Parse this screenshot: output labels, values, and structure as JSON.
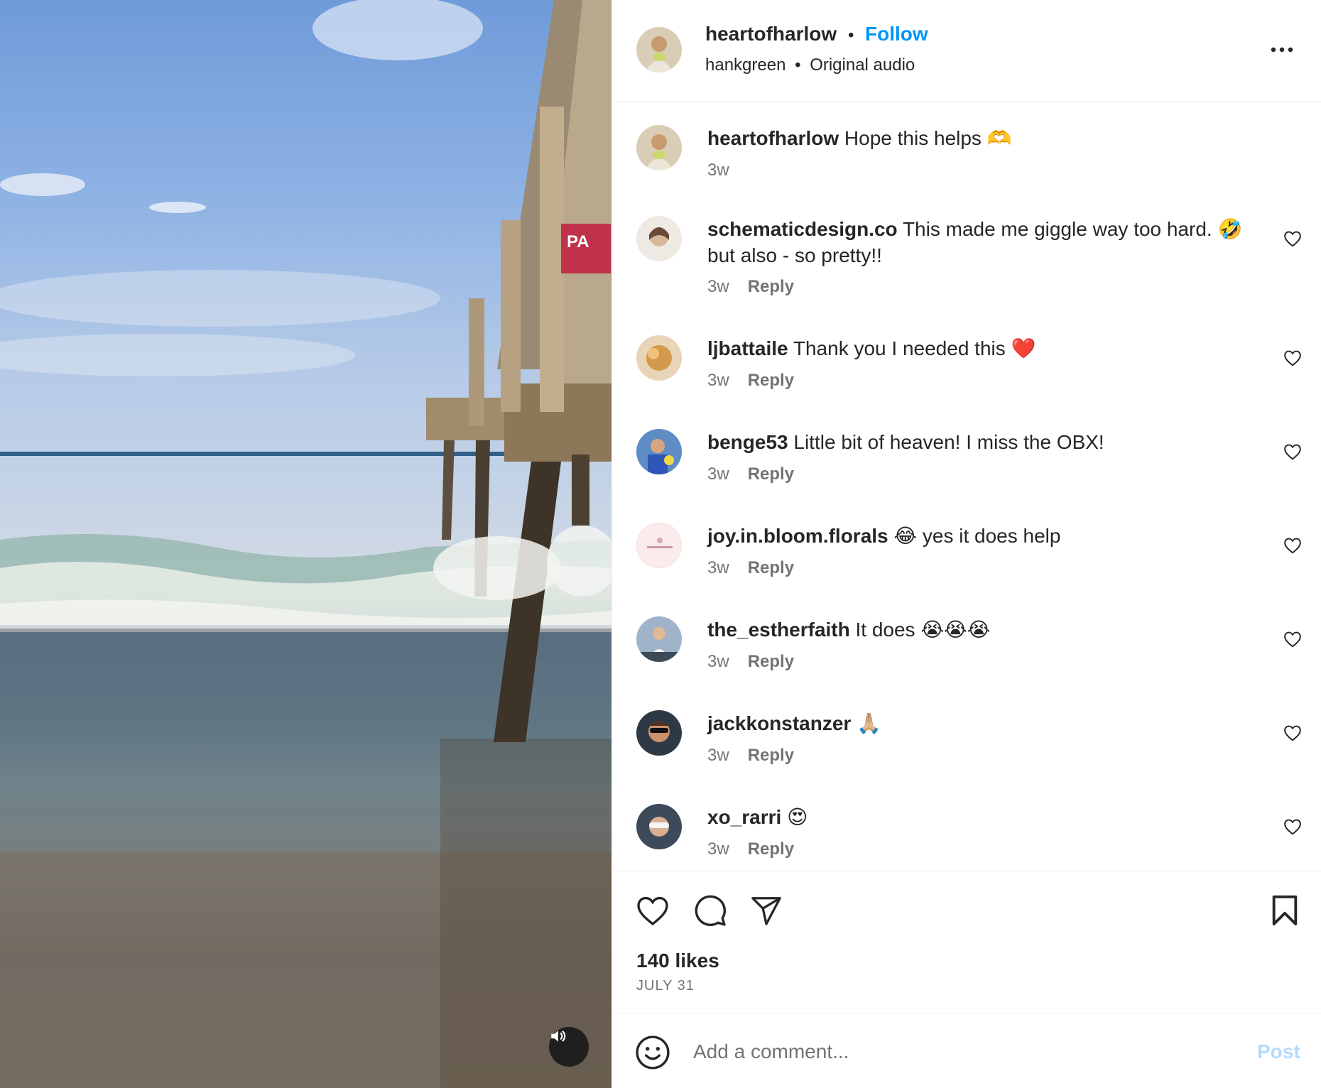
{
  "header": {
    "username": "heartofharlow",
    "separator": "•",
    "follow_label": "Follow",
    "audio_user": "hankgreen",
    "audio_separator": "•",
    "audio_label": "Original audio"
  },
  "comments": [
    {
      "username": "heartofharlow",
      "text": "Hope this helps 🫶",
      "time": "3w",
      "reply": ""
    },
    {
      "username": "schematicdesign.co",
      "text": "This made me giggle way too hard. 🤣 but also - so pretty!!",
      "time": "3w",
      "reply": "Reply"
    },
    {
      "username": "ljbattaile",
      "text": "Thank you I needed this ❤️",
      "time": "3w",
      "reply": "Reply"
    },
    {
      "username": "benge53",
      "text": "Little bit of heaven! I miss the OBX!",
      "time": "3w",
      "reply": "Reply"
    },
    {
      "username": "joy.in.bloom.florals",
      "text": "😂 yes it does help",
      "time": "3w",
      "reply": "Reply"
    },
    {
      "username": "the_estherfaith",
      "text": "It does 😭😭😭",
      "time": "3w",
      "reply": "Reply"
    },
    {
      "username": "jackkonstanzer",
      "text": "🙏🏼",
      "time": "3w",
      "reply": "Reply"
    },
    {
      "username": "xo_rarri",
      "text": "😍",
      "time": "3w",
      "reply": "Reply"
    }
  ],
  "post": {
    "likes": "140 likes",
    "date": "JULY 31"
  },
  "composer": {
    "placeholder": "Add a comment...",
    "post_label": "Post"
  },
  "icons": {
    "like": "heart-icon",
    "comment": "comment-icon",
    "share": "send-icon",
    "save": "bookmark-icon",
    "mute": "speaker-icon",
    "emoji": "smiley-icon",
    "more": "more-icon"
  },
  "colors": {
    "follow": "#0095f6",
    "post_disabled": "#b3dbff",
    "meta_gray": "#737373"
  }
}
